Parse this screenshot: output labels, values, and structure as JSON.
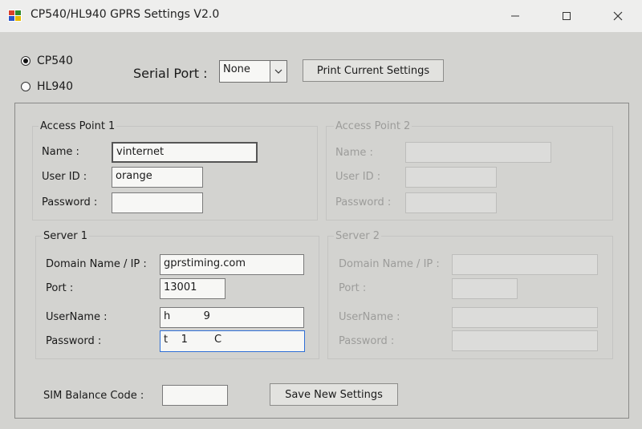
{
  "window": {
    "title": "CP540/HL940 GPRS Settings V2.0"
  },
  "device": {
    "options": [
      "CP540",
      "HL940"
    ],
    "selected": "CP540"
  },
  "serial_port": {
    "label": "Serial Port :",
    "value": "None"
  },
  "buttons": {
    "print": "Print Current Settings",
    "save": "Save New Settings"
  },
  "access_point_1": {
    "title": "Access Point 1",
    "name_label": "Name  :",
    "name_value": "vinternet",
    "userid_label": "User ID  :",
    "userid_value": "orange",
    "password_label": "Password  :",
    "password_value": ""
  },
  "access_point_2": {
    "title": "Access Point 2",
    "name_label": "Name  :",
    "userid_label": "User ID  :",
    "password_label": "Password  :"
  },
  "server_1": {
    "title": "Server 1",
    "domain_label": "Domain Name / IP  :",
    "domain_value": "gprstiming.com",
    "port_label": "Port  :",
    "port_value": "13001",
    "username_label": "UserName  :",
    "username_value": "h          9",
    "password_label": "Password  :",
    "password_value": "t    1        C"
  },
  "server_2": {
    "title": "Server 2",
    "domain_label": "Domain Name / IP  :",
    "port_label": "Port  :",
    "username_label": "UserName  :",
    "password_label": "Password  :"
  },
  "sim": {
    "label": "SIM Balance Code  :",
    "value": ""
  }
}
